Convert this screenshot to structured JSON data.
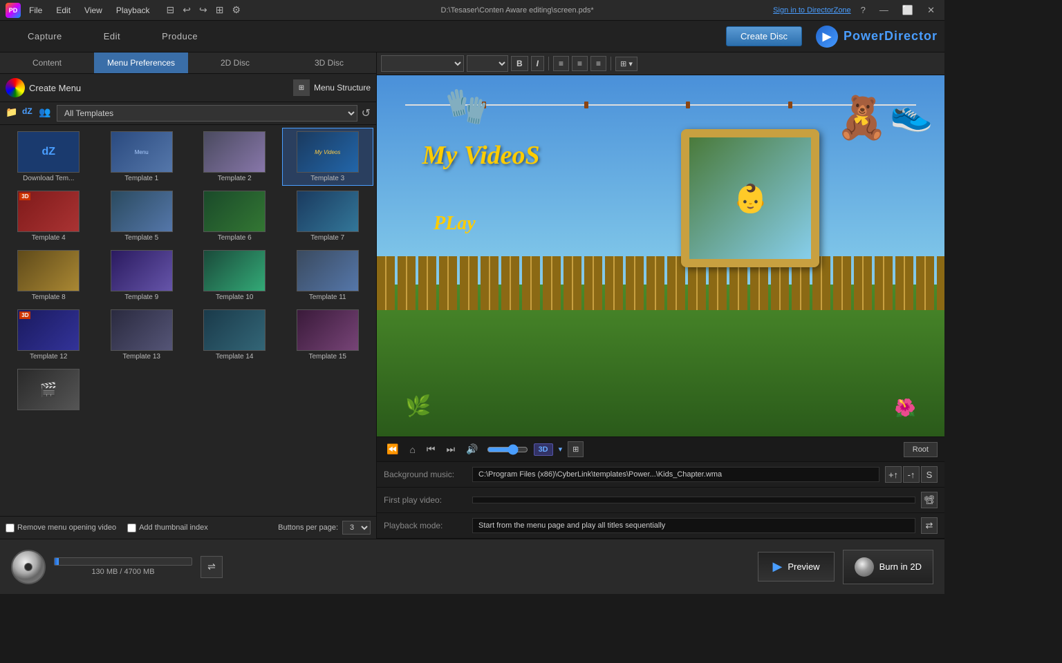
{
  "titleBar": {
    "title": "D:\\Tesaser\\Conten Aware editing\\screen.pds*",
    "menuItems": [
      "File",
      "Edit",
      "View",
      "Playback"
    ],
    "signIn": "Sign in to DirectorZone",
    "winButtons": [
      "?",
      "—",
      "⬜",
      "✕"
    ]
  },
  "header": {
    "navItems": [
      "Capture",
      "Edit",
      "Produce"
    ],
    "createDisc": "Create Disc",
    "logoText": "PowerDirector"
  },
  "leftPanel": {
    "tabs": [
      "Content",
      "Menu Preferences",
      "2D Disc",
      "3D Disc"
    ],
    "activeTab": "Menu Preferences",
    "createMenu": "Create Menu",
    "menuStructure": "Menu Structure",
    "filterOptions": [
      "All Templates"
    ],
    "templates": [
      {
        "id": "download",
        "label": "Download Tem...",
        "thumbClass": "thumb-download",
        "text": "dZ"
      },
      {
        "id": "t1",
        "label": "Template 1",
        "thumbClass": "thumb-1"
      },
      {
        "id": "t2",
        "label": "Template 2",
        "thumbClass": "thumb-2"
      },
      {
        "id": "t3",
        "label": "Template 3",
        "thumbClass": "thumb-3"
      },
      {
        "id": "t4",
        "label": "Template 4",
        "thumbClass": "thumb-4",
        "badge": "3D"
      },
      {
        "id": "t5",
        "label": "Template 5",
        "thumbClass": "thumb-5"
      },
      {
        "id": "t6",
        "label": "Template 6",
        "thumbClass": "thumb-6"
      },
      {
        "id": "t7",
        "label": "Template 7",
        "thumbClass": "thumb-7"
      },
      {
        "id": "t8",
        "label": "Template 8",
        "thumbClass": "thumb-8"
      },
      {
        "id": "t9",
        "label": "Template 9",
        "thumbClass": "thumb-9"
      },
      {
        "id": "t10",
        "label": "Template 10",
        "thumbClass": "thumb-10"
      },
      {
        "id": "t11",
        "label": "Template 11",
        "thumbClass": "thumb-11"
      },
      {
        "id": "t12",
        "label": "Template 12",
        "thumbClass": "thumb-12",
        "badge": "3D"
      },
      {
        "id": "t13",
        "label": "Template 13",
        "thumbClass": "thumb-13"
      },
      {
        "id": "t14",
        "label": "Template 14",
        "thumbClass": "thumb-14"
      },
      {
        "id": "t15",
        "label": "Template 15",
        "thumbClass": "thumb-15"
      }
    ],
    "extraThumbClass": "thumb-extra",
    "checkboxes": [
      {
        "id": "removeOpening",
        "label": "Remove menu opening video",
        "checked": false
      },
      {
        "id": "addThumbnail",
        "label": "Add thumbnail index",
        "checked": false
      }
    ],
    "buttonsPerPage": "Buttons per page:",
    "buttonsPerPageValue": "3"
  },
  "rightPanel": {
    "formatBar": {
      "fontDropdown": "",
      "sizeDropdown": "",
      "boldLabel": "B",
      "italicLabel": "I",
      "alignButtons": [
        "≡",
        "≡",
        "≡"
      ],
      "layoutLabel": "⊞"
    },
    "preview": {
      "titleText": "My VideoS",
      "playText": "PLay"
    },
    "playback": {
      "backBtn": "⏪",
      "homeBtn": "⌂",
      "prevBtn": "⏮",
      "nextBtn": "⏭",
      "volumeBtn": "🔊",
      "badge3D": "3D",
      "rootBtn": "Root"
    },
    "infoRows": [
      {
        "label": "Background music:",
        "value": "C:\\Program Files (x86)\\CyberLink\\templates\\Power...\\Kids_Chapter.wma",
        "actions": [
          "+↑↑",
          "-↑↑",
          "S"
        ]
      },
      {
        "label": "First play video:",
        "value": "",
        "actions": [
          "📽"
        ]
      },
      {
        "label": "Playback mode:",
        "value": "Start from the menu page and play all titles sequentially",
        "actions": [
          "⇄"
        ]
      }
    ]
  },
  "statusBar": {
    "diskUsage": "130 MB / 4700 MB",
    "previewBtn": "Preview",
    "burnBtn": "Burn in 2D"
  }
}
